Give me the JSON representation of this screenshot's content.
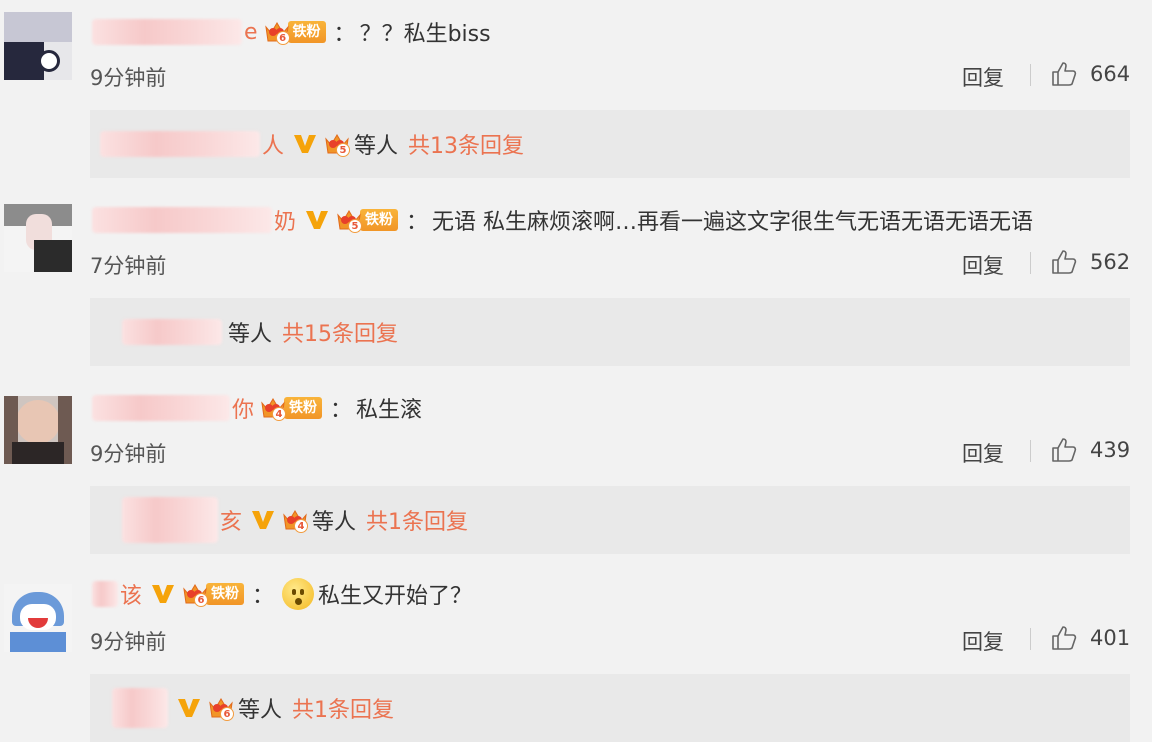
{
  "comments": [
    {
      "nick_tail": "e",
      "fan_level": "6",
      "fan_tag": "铁粉",
      "has_v": false,
      "colon": "：",
      "text": "？？私生biss",
      "time": "9分钟前",
      "reply_label": "回复",
      "likes": "664",
      "sub": {
        "tail": "人",
        "level": "5",
        "people_label": "等人",
        "count_label": "共13条回复"
      }
    },
    {
      "nick_tail": "奶",
      "fan_level": "5",
      "fan_tag": "铁粉",
      "has_v": true,
      "colon": "：",
      "text": "无语 私生麻烦滚啊…再看一遍这文字很生气无语无语无语无语",
      "time": "7分钟前",
      "reply_label": "回复",
      "likes": "562",
      "sub": {
        "tail": "",
        "level": "",
        "people_label": "等人",
        "count_label": "共15条回复"
      }
    },
    {
      "nick_tail": "你",
      "fan_level": "4",
      "fan_tag": "铁粉",
      "has_v": false,
      "colon": "：",
      "text": "私生滚",
      "time": "9分钟前",
      "reply_label": "回复",
      "likes": "439",
      "sub": {
        "tail": "亥",
        "level": "4",
        "people_label": "等人",
        "count_label": "共1条回复"
      }
    },
    {
      "nick_tail": "该",
      "fan_level": "6",
      "fan_tag": "铁粉",
      "has_v": true,
      "colon": "：",
      "text": "私生又开始了？",
      "time": "9分钟前",
      "reply_label": "回复",
      "likes": "401",
      "sub": {
        "tail": "",
        "level": "6",
        "people_label": "等人",
        "count_label": "共1条回复"
      }
    }
  ],
  "colors": {
    "accent": "#eb7350",
    "v_badge": "#f5a30a",
    "fan_tag": "#f19527",
    "background": "#f2f2f2",
    "sub_box": "#e9e9e9"
  },
  "icons": {
    "like": "thumbs-up-icon",
    "crown": "crown-fan-icon",
    "v": "verified-v-icon",
    "emoji": "surprised-face-emoji-icon"
  }
}
